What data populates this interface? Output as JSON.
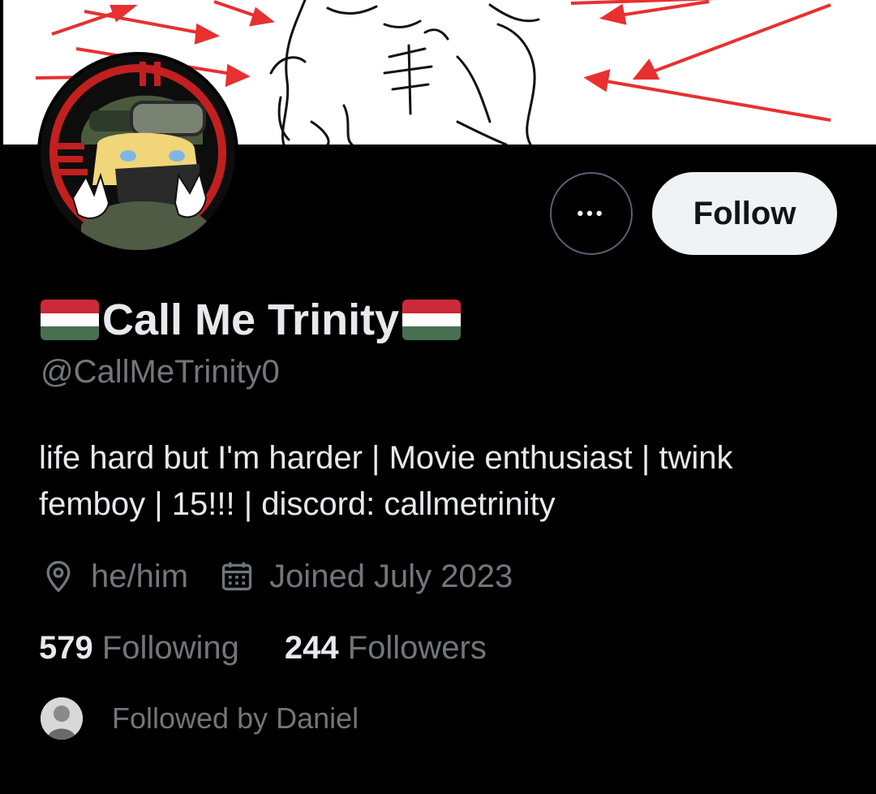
{
  "profile": {
    "display_name": "Call Me Trinity",
    "handle": "@CallMeTrinity0",
    "bio": "life hard but I'm harder | Movie enthusiast | twink femboy | 15!!! | discord: callmetrinity",
    "flag_colors": [
      "#ce2939",
      "#ffffff",
      "#477050"
    ],
    "location_icon": "location-pin-icon",
    "location": "he/him",
    "calendar_icon": "calendar-icon",
    "joined": "Joined July 2023"
  },
  "actions": {
    "more_label": "•••",
    "follow_label": "Follow"
  },
  "stats": {
    "following_count": "579",
    "following_label": "Following",
    "followers_count": "244",
    "followers_label": "Followers"
  },
  "followed_by": {
    "text": "Followed by Daniel"
  },
  "colors": {
    "background": "#000000",
    "primary_text": "#e7e9ea",
    "secondary_text": "#71767b",
    "follow_button_bg": "#eff3f4"
  }
}
